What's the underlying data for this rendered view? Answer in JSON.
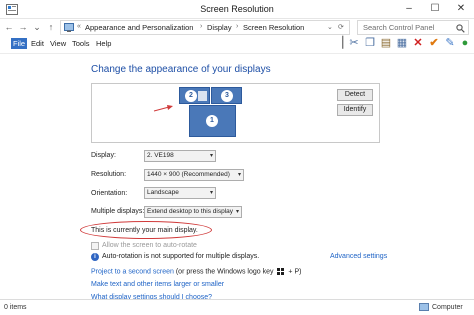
{
  "window": {
    "title": "Screen Resolution"
  },
  "nav": {
    "breadcrumb": [
      "Appearance and Personalization",
      "Display",
      "Screen Resolution"
    ],
    "search_placeholder": "Search Control Panel"
  },
  "menu": [
    "File",
    "Edit",
    "View",
    "Tools",
    "Help"
  ],
  "page": {
    "heading": "Change the appearance of your displays",
    "monitors": [
      "1",
      "2",
      "3"
    ],
    "detect_label": "Detect",
    "identify_label": "Identify"
  },
  "settings": {
    "display": {
      "label": "Display:",
      "value": "2. VE198"
    },
    "resolution": {
      "label": "Resolution:",
      "value": "1440 × 900 (Recommended)"
    },
    "orientation": {
      "label": "Orientation:",
      "value": "Landscape"
    },
    "multiple": {
      "label": "Multiple displays:",
      "value": "Extend desktop to this display"
    }
  },
  "main_note": "This is currently your main display.",
  "auto_rotate": "Allow the screen to auto-rotate",
  "info_text": "Auto-rotation is not supported for multiple displays.",
  "advanced_link": "Advanced settings",
  "links": {
    "project": "Project to a second screen",
    "project_tail_open": "(or press the Windows logo key",
    "project_tail_close": "+ P)",
    "text_size": "Make text and other items larger or smaller",
    "what_settings": "What display settings should I choose?"
  },
  "status": {
    "items": "0 items",
    "location": "Computer"
  },
  "colors": {
    "accent": "#3470c4",
    "link": "#1e63c6",
    "heading": "#1e4fa6",
    "monitor": "#4a78b8",
    "annotation": "#d03a3a"
  }
}
